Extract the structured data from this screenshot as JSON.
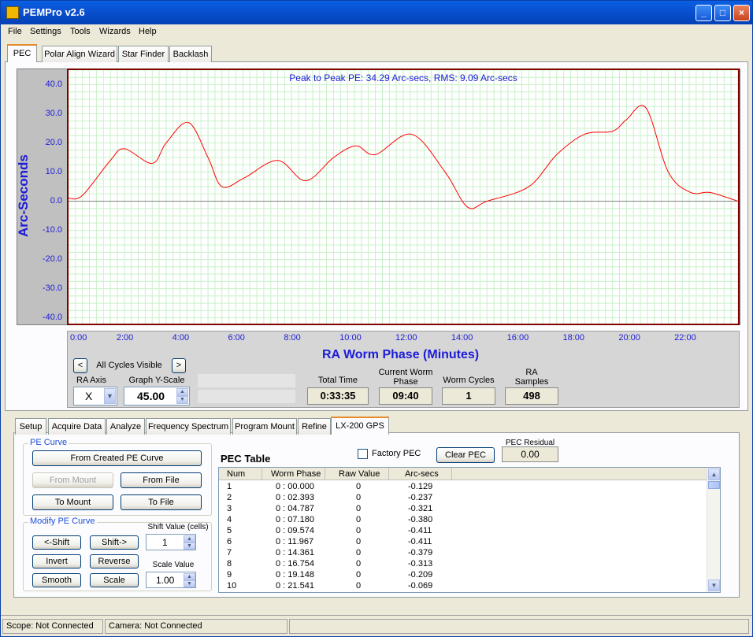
{
  "window": {
    "title": "PEMPro v2.6",
    "min": "_",
    "max": "□",
    "close": "×"
  },
  "menu": [
    "File",
    "Settings",
    "Tools",
    "Wizards",
    "Help"
  ],
  "top_tabs": [
    "PEC",
    "Polar Align Wizard",
    "Star Finder",
    "Backlash"
  ],
  "graph": {
    "title": "Peak to Peak PE: 34.29 Arc-secs,  RMS: 9.09 Arc-secs",
    "ylabel": "Arc-Seconds",
    "xlabel": "RA Worm Phase (Minutes)",
    "line_color": "#ff0000"
  },
  "chart_data": {
    "type": "line",
    "yticks": [
      "40.0",
      "30.0",
      "20.0",
      "10.0",
      "0.0",
      "-10.0",
      "-20.0",
      "-30.0",
      "-40.0"
    ],
    "xticks": [
      "0:00",
      "2:00",
      "4:00",
      "6:00",
      "8:00",
      "10:00",
      "12:00",
      "14:00",
      "16:00",
      "18:00",
      "20:00",
      "22:00"
    ],
    "ylim": [
      -42,
      45
    ],
    "xlim": [
      0,
      24
    ],
    "x": [
      0,
      0.5,
      1.5,
      2,
      3,
      3.5,
      4.3,
      5,
      5.5,
      6.3,
      7.5,
      8.5,
      9.5,
      10.3,
      11,
      12.3,
      13.5,
      14.3,
      15,
      16.5,
      17.5,
      18.5,
      19.5,
      20,
      20.7,
      21.5,
      22.3,
      23,
      24
    ],
    "y": [
      1,
      2,
      14,
      18,
      13,
      20,
      27,
      15,
      5,
      8,
      14,
      7,
      15,
      19,
      16,
      23,
      10,
      -2,
      0,
      5,
      16,
      23,
      24,
      28,
      32,
      10,
      3,
      3,
      0
    ]
  },
  "controls": {
    "cycles_visible": "All Cycles Visible",
    "prev": "<",
    "next": ">",
    "ra_axis_label": "RA Axis",
    "ra_axis_value": "X",
    "yscale_label": "Graph Y-Scale",
    "yscale_value": "45.00",
    "total_time_label": "Total Time",
    "total_time": "0:33:35",
    "worm_phase_label": "Current Worm Phase",
    "worm_phase": "09:40",
    "worm_cycles_label": "Worm Cycles",
    "worm_cycles": "1",
    "ra_samples_label": "RA Samples",
    "ra_samples": "498"
  },
  "bottom_tabs": [
    "Setup",
    "Acquire Data",
    "Analyze",
    "Frequency Spectrum",
    "Program Mount",
    "Refine",
    "LX-200 GPS"
  ],
  "pe_curve": {
    "group": "PE Curve",
    "from_created": "From Created PE Curve",
    "from_mount": "From Mount",
    "from_file": "From File",
    "to_mount": "To Mount",
    "to_file": "To File"
  },
  "modify": {
    "group": "Modify PE Curve",
    "shift_left": "<-Shift",
    "shift_right": "Shift->",
    "shift_label": "Shift Value (cells)",
    "shift_value": "1",
    "invert": "Invert",
    "reverse": "Reverse",
    "smooth": "Smooth",
    "scale": "Scale",
    "scale_label": "Scale Value",
    "scale_value": "1.00"
  },
  "pec": {
    "table_title": "PEC Table",
    "factory_pec": "Factory PEC",
    "clear_pec": "Clear PEC",
    "residual_label": "PEC Residual",
    "residual_value": "0.00",
    "headers": [
      "Num",
      "Worm Phase",
      "Raw Value",
      "Arc-secs"
    ],
    "rows": [
      [
        "1",
        "0 : 00.000",
        "0",
        "-0.129"
      ],
      [
        "2",
        "0 : 02.393",
        "0",
        "-0.237"
      ],
      [
        "3",
        "0 : 04.787",
        "0",
        "-0.321"
      ],
      [
        "4",
        "0 : 07.180",
        "0",
        "-0.380"
      ],
      [
        "5",
        "0 : 09.574",
        "0",
        "-0.411"
      ],
      [
        "6",
        "0 : 11.967",
        "0",
        "-0.411"
      ],
      [
        "7",
        "0 : 14.361",
        "0",
        "-0.379"
      ],
      [
        "8",
        "0 : 16.754",
        "0",
        "-0.313"
      ],
      [
        "9",
        "0 : 19.148",
        "0",
        "-0.209"
      ],
      [
        "10",
        "0 : 21.541",
        "0",
        "-0.069"
      ]
    ]
  },
  "status": {
    "scope": "Scope: Not Connected",
    "camera": "Camera: Not Connected"
  }
}
